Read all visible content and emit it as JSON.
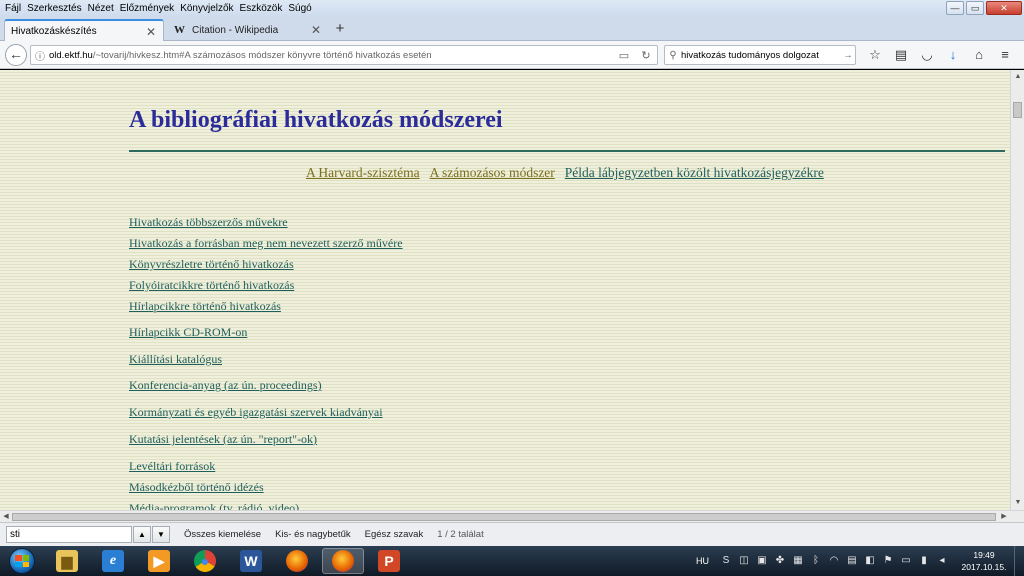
{
  "menubar": {
    "items": [
      "Fájl",
      "Szerkesztés",
      "Nézet",
      "Előzmények",
      "Könyvjelzők",
      "Eszközök",
      "Súgó"
    ]
  },
  "window_controls": {
    "minimize": "—",
    "maximize": "▭",
    "close": "✕"
  },
  "tabs": [
    {
      "label": "Hivatkozáskészítés",
      "active": true
    },
    {
      "label": "Citation - Wikipedia",
      "active": false,
      "favicon": "W"
    }
  ],
  "new_tab_symbol": "+",
  "nav": {
    "url_domain": "old.ektf.hu",
    "url_rest": "/~tovarij/hivkesz.htm#A számozásos módszer könyvre történő hivatkozás esetén",
    "search_value": "hivatkozás tudományos dolgozat"
  },
  "page": {
    "title": "A bibliográfiai hivatkozás módszerei",
    "top_links": [
      {
        "label": "A Harvard-szisztéma ",
        "style": "olive"
      },
      {
        "label": "A számozásos módszer",
        "style": "olive"
      },
      {
        "label": "Példa lábjegyzetben közölt hivatkozásjegyzékre",
        "style": "teal"
      }
    ],
    "links": [
      "Hivatkozás többszerzős művekre ",
      "Hivatkozás a forrásban meg nem nevezett szerző művére ",
      "Könyvrészletre történő hivatkozás",
      "Folyóiratcikkre történő hivatkozás",
      "Hírlapcikkre történő hivatkozás",
      "Hírlapcikk CD-ROM-on",
      "Kiállítási katalógus",
      "Konferencia-anyag (az ún. proceedings)",
      "Kormányzati és egyéb igazgatási szervek kiadványai",
      "Kutatási jelentések (az ún. \"report\"-ok)",
      "Levéltári források",
      "Másodkézből történő idézés",
      "Média-programok (tv, rádió, video)"
    ]
  },
  "findbar": {
    "value": "sti",
    "highlight_all": "Összes kiemelése",
    "match_case": "Kis- és nagybetűk",
    "whole_words": "Egész szavak",
    "result_count": "1 / 2 találat"
  },
  "taskbar": {
    "apps": [
      {
        "name": "file-explorer",
        "color": "#e8c45a",
        "glyph": "▆"
      },
      {
        "name": "internet-explorer",
        "color": "#2a7fd4",
        "glyph": "e"
      },
      {
        "name": "media-player",
        "color": "#f39a25",
        "glyph": "▶"
      },
      {
        "name": "chrome",
        "color": "#3a9b4b",
        "glyph": "◉"
      },
      {
        "name": "word",
        "color": "#2b579a",
        "glyph": "W"
      },
      {
        "name": "firefox",
        "color": "#e66000",
        "glyph": "◍"
      },
      {
        "name": "firefox-active",
        "color": "#e66000",
        "glyph": "◍"
      },
      {
        "name": "powerpoint",
        "color": "#d24726",
        "glyph": "P"
      }
    ],
    "language": "HU",
    "clock_time": "19:49",
    "clock_date": "2017.10.15."
  }
}
